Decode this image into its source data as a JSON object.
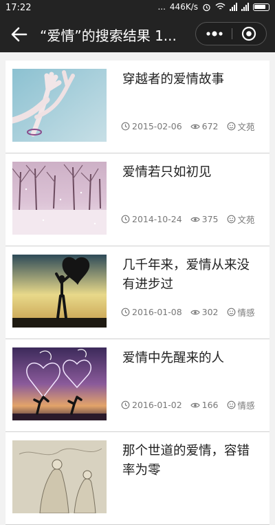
{
  "status": {
    "time": "17:22",
    "speed": "446K/s",
    "dots": "..."
  },
  "nav": {
    "title": "“爱情”的搜索结果 1..."
  },
  "articles": [
    {
      "title": "穿越者的爱情故事",
      "date": "2015-02-06",
      "views": "672",
      "category": "文苑",
      "image": "hands-to-sky"
    },
    {
      "title": "爱情若只如初见",
      "date": "2014-10-24",
      "views": "375",
      "category": "文苑",
      "image": "snowy-trees"
    },
    {
      "title": "几千年来，爱情从来没有进步过",
      "date": "2016-01-08",
      "views": "302",
      "category": "情感",
      "image": "silhouette-heart-balloon"
    },
    {
      "title": "爱情中先醒来的人",
      "date": "2016-01-02",
      "views": "166",
      "category": "情感",
      "image": "jumping-couple-hearts"
    },
    {
      "title": "那个世道的爱情，容错率为零",
      "date": "",
      "views": "",
      "category": "",
      "image": "ancient-painting"
    }
  ],
  "colors": {
    "navbar": "#232323",
    "background": "#f2f2f2",
    "meta_text": "#777777",
    "title_text": "#222222"
  }
}
